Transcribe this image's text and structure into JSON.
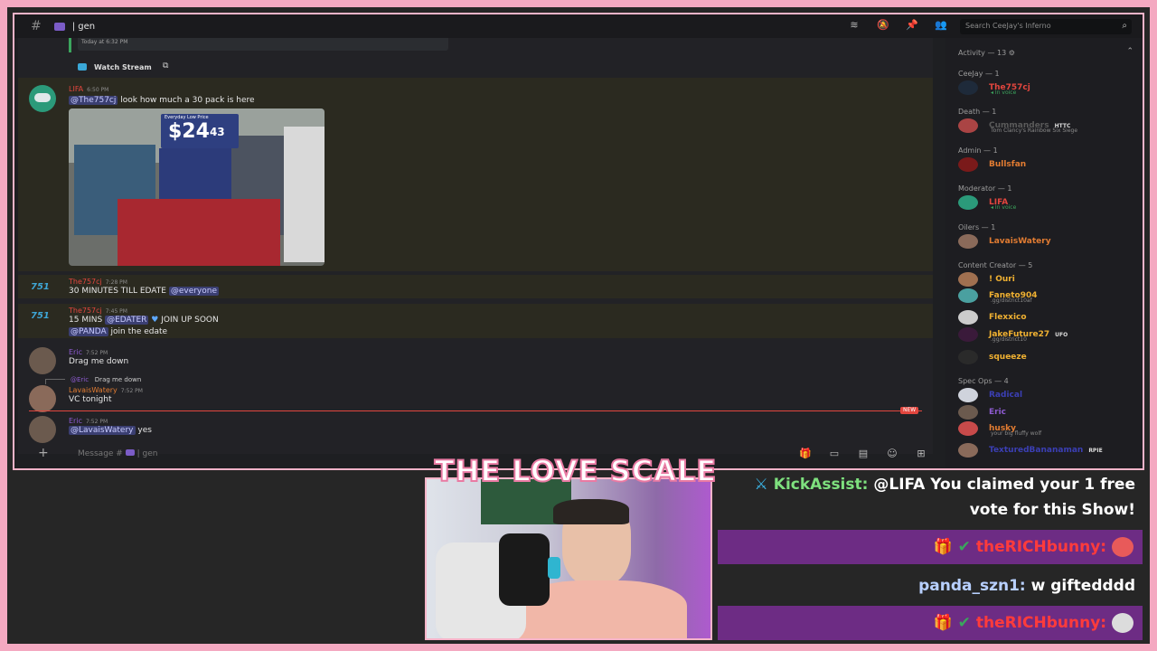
{
  "topbar": {
    "channel": "| gen",
    "search_placeholder": "Search CeeJay's Inferno"
  },
  "chat": {
    "prev_timestamp": "Today at 6:32 PM",
    "watch_stream": "Watch Stream",
    "messages": [
      {
        "author": "LIFA",
        "author_color": "#e2463e",
        "time": "6:50 PM",
        "mention": "@The757cj",
        "text": "look how much a 30 pack is here"
      },
      {
        "author": "The757cj",
        "author_color": "#e2463e",
        "time": "7:28 PM",
        "text": "30 MINUTES TILL EDATE",
        "mention": "@everyone"
      },
      {
        "author": "The757cj",
        "author_color": "#e2463e",
        "time": "7:45 PM",
        "text_a": "15 MINS",
        "mention_a": "@EDATER",
        "text_b": "JOIN UP SOON",
        "mention_b": "@PANDA",
        "text_c": "join the edate"
      },
      {
        "author": "Eric",
        "author_color": "#8e5bd1",
        "time": "7:52 PM",
        "text": "Drag me down"
      },
      {
        "reply_author": "@Eric",
        "reply_text": "Drag me down",
        "author": "LavaisWatery",
        "author_color": "#e27c32",
        "time": "7:52 PM",
        "text": "VC tonight"
      },
      {
        "author": "Eric",
        "author_color": "#8e5bd1",
        "time": "7:52 PM",
        "mention": "@LavaisWatery",
        "text": "yes"
      }
    ],
    "price_label": "Everyday Low Price",
    "price": "$24",
    "price_cents": "43",
    "new_badge": "NEW",
    "input_placeholder": "Message #",
    "input_channel": "| gen"
  },
  "members": {
    "activity": "Activity — 13",
    "sections": [
      {
        "title": "CeeJay — 1",
        "members": [
          {
            "name": "The757cj",
            "color": "#e2463e",
            "sub": "In voice"
          }
        ]
      },
      {
        "title": "Death — 1",
        "members": [
          {
            "name": "Cummanders",
            "color": "#5a5a5a",
            "tag": "HTTC",
            "sub": "Tom Clancy's Rainbow Six Siege"
          }
        ]
      },
      {
        "title": "Admin — 1",
        "members": [
          {
            "name": "Bullsfan",
            "color": "#e27c32"
          }
        ]
      },
      {
        "title": "Moderator — 1",
        "members": [
          {
            "name": "LIFA",
            "color": "#e2463e",
            "sub": "In voice"
          }
        ]
      },
      {
        "title": "Oilers — 1",
        "members": [
          {
            "name": "LavaisWatery",
            "color": "#e27c32"
          }
        ]
      },
      {
        "title": "Content Creator — 5",
        "members": [
          {
            "name": "! Ouri",
            "color": "#f0b132"
          },
          {
            "name": "Faneto904",
            "color": "#f0b132",
            "sub": ".gg/district10af"
          },
          {
            "name": "Flexxico",
            "color": "#f0b132"
          },
          {
            "name": "JakeFuture27",
            "color": "#f0b132",
            "tag": "UFO",
            "sub": ".gg/district10"
          },
          {
            "name": "squeeze",
            "color": "#f0b132"
          }
        ]
      },
      {
        "title": "Spec Ops — 4",
        "members": [
          {
            "name": "Radical",
            "color": "#3b3fb5"
          },
          {
            "name": "Eric",
            "color": "#8e5bd1"
          },
          {
            "name": "husky",
            "color": "#e27c32",
            "sub": "your big fluffy wolf"
          },
          {
            "name": "TexturedBananaman",
            "color": "#3b3fb5",
            "tag": "RPIE"
          }
        ]
      }
    ]
  },
  "overlay": {
    "title": "THE LOVE SCALE",
    "feed": [
      {
        "user": "KickAssist:",
        "user_color": "#7ee07e",
        "text": "@LIFA You claimed your 1 free",
        "text2": "vote for this Show!"
      },
      {
        "user": "theRICHbunny:",
        "user_color": "#ff3b3b",
        "text": ""
      },
      {
        "user": "panda_szn1:",
        "user_color": "#b8d0ff",
        "text": "w giftedddd"
      },
      {
        "user": "theRICHbunny:",
        "user_color": "#ff3b3b",
        "text": ""
      }
    ]
  }
}
